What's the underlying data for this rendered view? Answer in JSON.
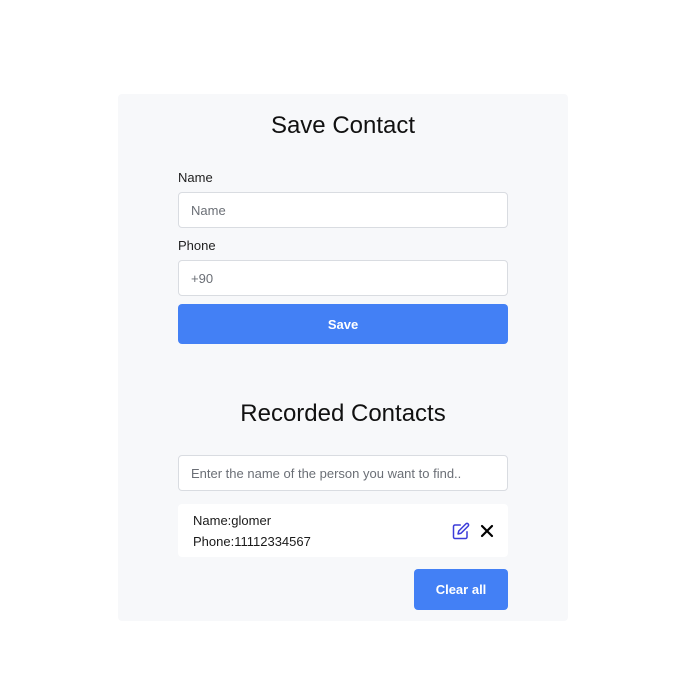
{
  "save_form": {
    "title": "Save Contact",
    "name_label": "Name",
    "name_placeholder": "Name",
    "name_value": "",
    "phone_label": "Phone",
    "phone_placeholder": "+90",
    "phone_value": "",
    "save_button": "Save"
  },
  "recorded": {
    "title": "Recorded Contacts",
    "search_placeholder": "Enter the name of the person you want to find..",
    "search_value": "",
    "contacts": [
      {
        "name_text": "Name:glomer",
        "phone_text": "Phone:11112334567"
      }
    ],
    "clear_button": "Clear all"
  },
  "icons": {
    "edit": "edit-icon",
    "delete": "close-icon"
  },
  "colors": {
    "accent": "#4380f5",
    "edit_icon": "#3b3bd9",
    "card_bg": "#f7f8fa"
  }
}
